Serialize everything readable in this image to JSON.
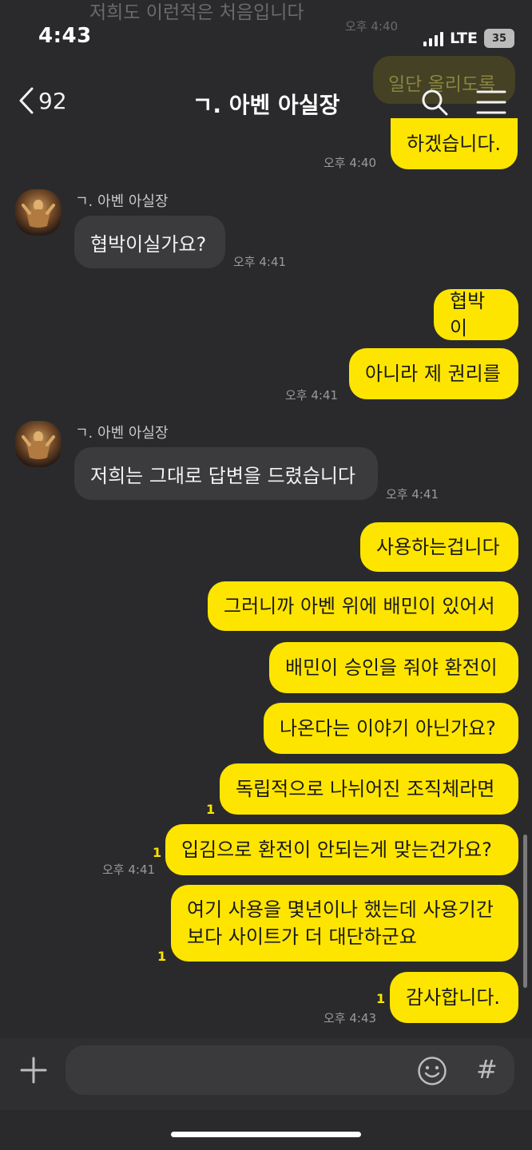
{
  "status": {
    "time": "4:43",
    "network": "LTE",
    "battery": "35"
  },
  "header": {
    "back_count": "92",
    "title": "ㄱ. 아벤 아실장"
  },
  "ghost_top": {
    "text": "저희도 이런적은 처음입니다",
    "time": "오후 4:40",
    "bubble": "일단 올리도록"
  },
  "messages": {
    "m1": {
      "text": "하겠습니다.",
      "time": "오후 4:40"
    },
    "sender1": "ㄱ. 아벤 아실장",
    "m2": {
      "text": "협박이실가요?",
      "time": "오후 4:41"
    },
    "m3": {
      "text": "협박이"
    },
    "m4": {
      "text": "아니라 제 권리를",
      "time": "오후 4:41"
    },
    "sender2": "ㄱ. 아벤 아실장",
    "m5": {
      "text": "저희는 그대로 답변을 드렸습니다",
      "time": "오후 4:41"
    },
    "m6": {
      "text": "사용하는겁니다"
    },
    "m7": {
      "text": "그러니까 아벤 위에 배민이 있어서"
    },
    "m8": {
      "text": "배민이 승인을 줘야 환전이"
    },
    "m9": {
      "text": "나온다는 이야기 아닌가요?"
    },
    "m10": {
      "text": "독립적으로 나뉘어진 조직체라면",
      "unread": "1"
    },
    "m11": {
      "text": "입김으로 환전이 안되는게 맞는건가요?",
      "unread": "1",
      "time": "오후 4:41"
    },
    "m12": {
      "line1": "여기 사용을 몇년이나 했는데 사용기간",
      "line2": "보다 사이트가 더 대단하군요",
      "unread": "1"
    },
    "m13": {
      "text": "감사합니다.",
      "unread": "1",
      "time": "오후 4:43"
    }
  },
  "input": {
    "placeholder": ""
  },
  "icons": {
    "back": "chevron-left-icon",
    "search": "search-icon",
    "menu": "hamburger-menu-icon",
    "plus": "plus-icon",
    "emoji": "smiley-icon",
    "hash": "hash-icon"
  },
  "colors": {
    "bubble_mine": "#fee500",
    "bubble_other": "#3b3b3e",
    "background": "#2a2a2c",
    "unread": "#fee500"
  },
  "hash_symbol": "#"
}
